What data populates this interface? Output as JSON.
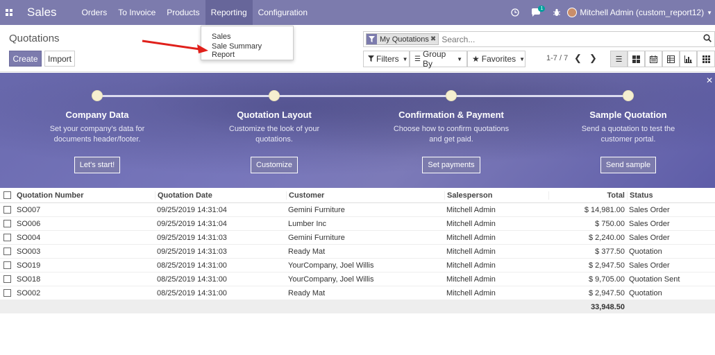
{
  "topbar": {
    "app_name": "Sales",
    "menu": [
      "Orders",
      "To Invoice",
      "Products",
      "Reporting",
      "Configuration"
    ],
    "chat_badge": "1",
    "user": "Mitchell Admin (custom_report12)"
  },
  "control": {
    "title": "Quotations",
    "create_label": "Create",
    "import_label": "Import",
    "search_facet": "My Quotations",
    "search_placeholder": "Search...",
    "filters_label": "Filters",
    "groupby_label": "Group By",
    "favorites_label": "Favorites",
    "pager": "1-7 / 7"
  },
  "reporting_menu": [
    "Sales",
    "Sale Summary Report"
  ],
  "banner": {
    "steps": [
      {
        "title": "Company Data",
        "desc": "Set your company's data for documents header/footer.",
        "action": "Let's start!"
      },
      {
        "title": "Quotation Layout",
        "desc": "Customize the look of your quotations.",
        "action": "Customize"
      },
      {
        "title": "Confirmation & Payment",
        "desc": "Choose how to confirm quotations and get paid.",
        "action": "Set payments"
      },
      {
        "title": "Sample Quotation",
        "desc": "Send a quotation to test the customer portal.",
        "action": "Send sample"
      }
    ]
  },
  "table": {
    "headers": [
      "Quotation Number",
      "Quotation Date",
      "Customer",
      "Salesperson",
      "Total",
      "Status"
    ],
    "rows": [
      [
        "SO007",
        "09/25/2019 14:31:04",
        "Gemini Furniture",
        "Mitchell Admin",
        "$ 14,981.00",
        "Sales Order"
      ],
      [
        "SO006",
        "09/25/2019 14:31:04",
        "Lumber Inc",
        "Mitchell Admin",
        "$ 750.00",
        "Sales Order"
      ],
      [
        "SO004",
        "09/25/2019 14:31:03",
        "Gemini Furniture",
        "Mitchell Admin",
        "$ 2,240.00",
        "Sales Order"
      ],
      [
        "SO003",
        "09/25/2019 14:31:03",
        "Ready Mat",
        "Mitchell Admin",
        "$ 377.50",
        "Quotation"
      ],
      [
        "SO019",
        "08/25/2019 14:31:00",
        "YourCompany, Joel Willis",
        "Mitchell Admin",
        "$ 2,947.50",
        "Sales Order"
      ],
      [
        "SO018",
        "08/25/2019 14:31:00",
        "YourCompany, Joel Willis",
        "Mitchell Admin",
        "$ 9,705.00",
        "Quotation Sent"
      ],
      [
        "SO002",
        "08/25/2019 14:31:00",
        "Ready Mat",
        "Mitchell Admin",
        "$ 2,947.50",
        "Quotation"
      ]
    ],
    "total": "33,948.50"
  },
  "colors": {
    "brand": "#7c7bad",
    "annotation_arrow": "#e0201b"
  }
}
